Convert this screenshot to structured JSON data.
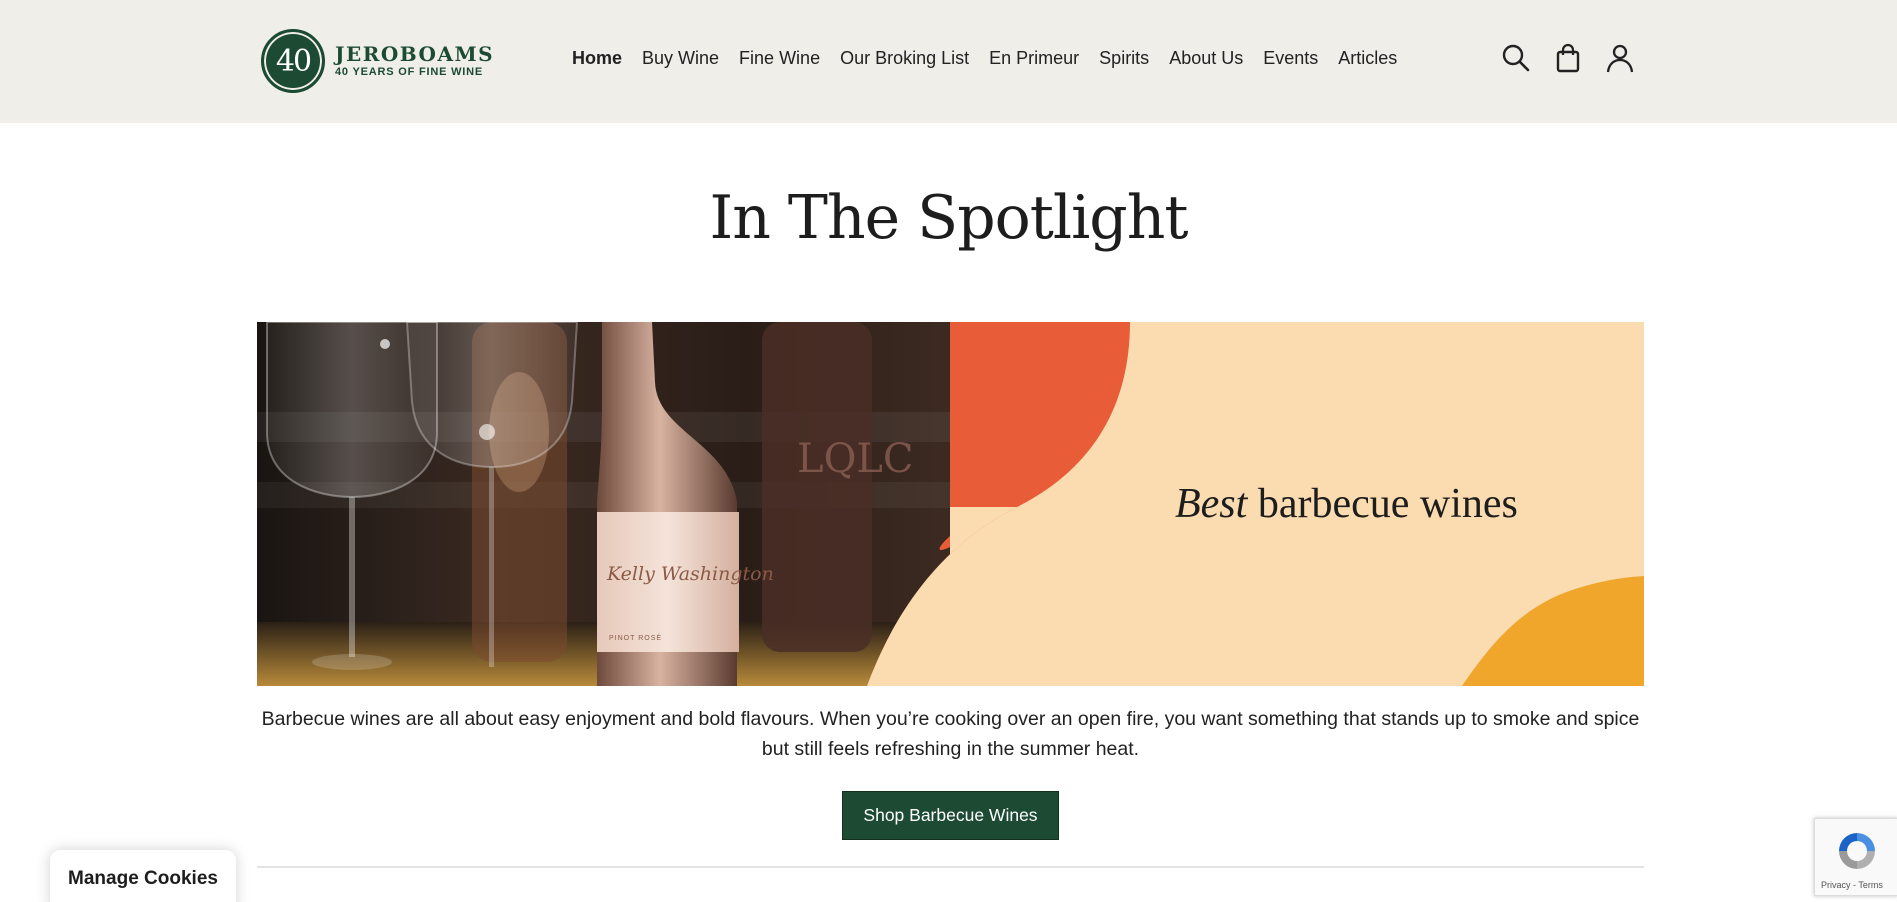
{
  "brand": {
    "badge_number": "40",
    "name": "JEROBOAMS",
    "tagline": "40 YEARS OF FINE WINE",
    "color": "#1c4a32"
  },
  "nav": {
    "items": [
      {
        "label": "Home",
        "active": true
      },
      {
        "label": "Buy Wine",
        "active": false
      },
      {
        "label": "Fine Wine",
        "active": false
      },
      {
        "label": "Our Broking List",
        "active": false
      },
      {
        "label": "En Primeur",
        "active": false
      },
      {
        "label": "Spirits",
        "active": false
      },
      {
        "label": "About Us",
        "active": false
      },
      {
        "label": "Events",
        "active": false
      },
      {
        "label": "Articles",
        "active": false
      }
    ]
  },
  "header_icons": [
    "search-icon",
    "shopping-bag-icon",
    "account-icon"
  ],
  "spotlight": {
    "title": "In The Spotlight",
    "banner": {
      "headline_italic": "Best",
      "headline_rest": " barbecue wines",
      "bottle_label_script": "Kelly Washington",
      "bottle_label_small": "PINOT ROSÉ",
      "background_bottle_text": "LQLC",
      "colors": {
        "peach": "#fadcb0",
        "orange_red": "#e85c38",
        "amber": "#f0a52b"
      }
    },
    "description": "Barbecue wines are all about easy enjoyment and bold flavours. When you’re cooking over an open fire, you want something that stands up to smoke and spice but still feels refreshing in the summer heat.",
    "button_label": "Shop Barbecue Wines"
  },
  "cookies": {
    "label": "Manage Cookies"
  },
  "recaptcha": {
    "links": "Privacy - Terms"
  }
}
